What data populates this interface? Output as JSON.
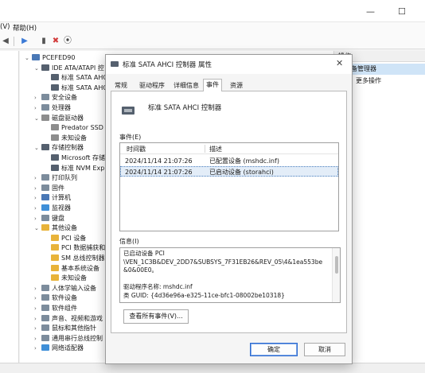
{
  "menu": {
    "view_fragment": "(V)",
    "help": "帮助(H)"
  },
  "window_controls": {
    "minimize": "—",
    "maximize": "☐"
  },
  "toolbar": {
    "back": "◀",
    "forward": "▶",
    "delete": "✖",
    "scan": "⦿"
  },
  "tree": [
    {
      "label": "PCEFED90",
      "expanded": true,
      "icon": "computer-icon"
    },
    {
      "label": "IDE ATA/ATAPI 控",
      "expanded": true,
      "icon": "controller-icon"
    },
    {
      "label": "标准 SATA AHC",
      "icon": "controller-icon"
    },
    {
      "label": "标准 SATA AHC",
      "icon": "controller-icon"
    },
    {
      "label": "安全设备",
      "expanded": false,
      "icon": "shield-icon"
    },
    {
      "label": "处理器",
      "expanded": false,
      "icon": "cpu-icon"
    },
    {
      "label": "磁盘驱动器",
      "expanded": true,
      "icon": "disk-icon"
    },
    {
      "label": "Predator SSD",
      "icon": "disk-icon"
    },
    {
      "label": "未知设备",
      "icon": "disk-icon"
    },
    {
      "label": "存储控制器",
      "expanded": true,
      "icon": "storage-icon"
    },
    {
      "label": "Microsoft 存储",
      "icon": "storage-icon"
    },
    {
      "label": "标准 NVM Exp",
      "icon": "storage-icon"
    },
    {
      "label": "打印队列",
      "expanded": false,
      "icon": "printer-icon"
    },
    {
      "label": "固件",
      "expanded": false,
      "icon": "chip-icon"
    },
    {
      "label": "计算机",
      "expanded": false,
      "icon": "computer-icon"
    },
    {
      "label": "监视器",
      "expanded": false,
      "icon": "monitor-icon"
    },
    {
      "label": "键盘",
      "expanded": false,
      "icon": "keyboard-icon"
    },
    {
      "label": "其他设备",
      "expanded": true,
      "icon": "warning-icon"
    },
    {
      "label": "PCI 设备",
      "icon": "warning-icon"
    },
    {
      "label": "PCI 数据捕获和",
      "icon": "warning-icon"
    },
    {
      "label": "SM 总线控制器",
      "icon": "warning-icon"
    },
    {
      "label": "基本系统设备",
      "icon": "warning-icon"
    },
    {
      "label": "未知设备",
      "icon": "warning-icon"
    },
    {
      "label": "人体学输入设备",
      "expanded": false,
      "icon": "hid-icon"
    },
    {
      "label": "软件设备",
      "expanded": false,
      "icon": "chip-icon"
    },
    {
      "label": "软件组件",
      "expanded": false,
      "icon": "chip-icon"
    },
    {
      "label": "声音、视频和游戏",
      "expanded": false,
      "icon": "audio-icon"
    },
    {
      "label": "鼠标和其他指针",
      "expanded": false,
      "icon": "mouse-icon"
    },
    {
      "label": "通用串行总线控制",
      "expanded": false,
      "icon": "usb-icon"
    },
    {
      "label": "网络适配器",
      "expanded": false,
      "icon": "network-icon"
    }
  ],
  "actions": {
    "header": "操作",
    "selected": "备管理器",
    "more": "更多操作"
  },
  "dialog": {
    "title": "标准 SATA AHCI 控制器 属性",
    "close": "✕",
    "tabs": [
      "常规",
      "驱动程序",
      "详细信息",
      "事件",
      "资源"
    ],
    "active_tab": "事件",
    "device_name": "标准 SATA AHCI 控制器",
    "events_label": "事件(E)",
    "events_columns": [
      "时间戳",
      "描述"
    ],
    "events": [
      {
        "timestamp": "2024/11/14 21:07:26",
        "description": "已配置设备 (mshdc.inf)"
      },
      {
        "timestamp": "2024/11/14 21:07:26",
        "description": "已启动设备 (storahci)"
      }
    ],
    "info_label": "信息(I)",
    "info_lines": [
      "已启动设备 PCI",
      "\\VEN_1C3B&DEV_2DD7&SUBSYS_7F31EB26&REV_05\\4&1ea553be",
      "&0&00E0。",
      "",
      "驱动程序名称: mshdc.inf",
      "类 GUID: {4d36e96a-e325-11ce-bfc1-08002be10318}"
    ],
    "view_all_label": "查看所有事件(V)...",
    "ok_label": "确定",
    "cancel_label": "取消"
  }
}
